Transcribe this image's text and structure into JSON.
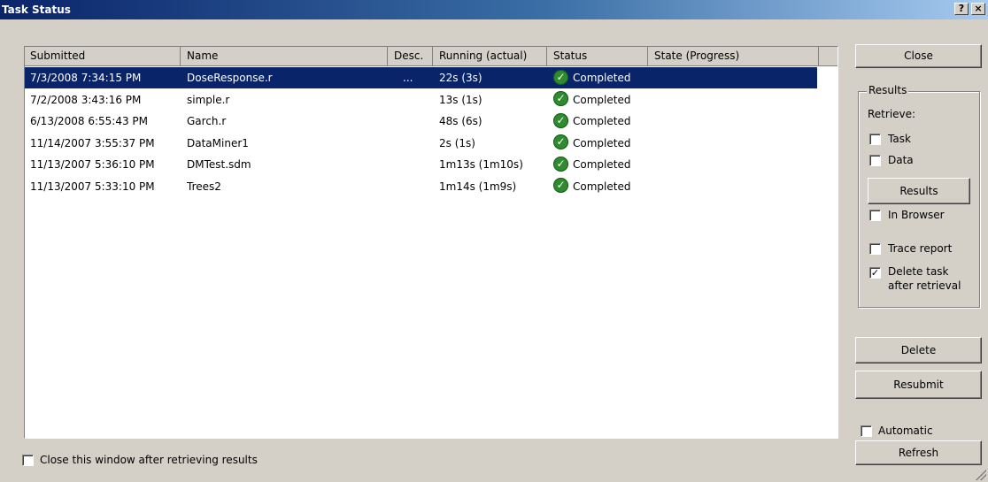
{
  "window": {
    "title": "Task Status",
    "help_label": "?",
    "close_label": "×"
  },
  "columns": [
    "Submitted",
    "Name",
    "Desc.",
    "Running (actual)",
    "Status",
    "State (Progress)"
  ],
  "tasks": [
    {
      "submitted": "7/3/2008 7:34:15 PM",
      "name": "DoseResponse.r",
      "desc": "...",
      "running": "22s (3s)",
      "status": "Completed",
      "state": "",
      "selected": true
    },
    {
      "submitted": "7/2/2008 3:43:16 PM",
      "name": "simple.r",
      "desc": "",
      "running": "13s (1s)",
      "status": "Completed",
      "state": ""
    },
    {
      "submitted": "6/13/2008 6:55:43 PM",
      "name": "Garch.r",
      "desc": "",
      "running": "48s (6s)",
      "status": "Completed",
      "state": ""
    },
    {
      "submitted": "11/14/2007 3:55:37 PM",
      "name": "DataMiner1",
      "desc": "",
      "running": "2s (1s)",
      "status": "Completed",
      "state": ""
    },
    {
      "submitted": "11/13/2007 5:36:10 PM",
      "name": "DMTest.sdm",
      "desc": "",
      "running": "1m13s (1m10s)",
      "status": "Completed",
      "state": ""
    },
    {
      "submitted": "11/13/2007 5:33:10 PM",
      "name": "Trees2",
      "desc": "",
      "running": "1m14s (1m9s)",
      "status": "Completed",
      "state": ""
    }
  ],
  "status_icon": "check-circle-icon",
  "right_panel": {
    "close_button": "Close",
    "results_group": "Results",
    "retrieve_label": "Retrieve:",
    "task_checkbox": {
      "label": "Task",
      "checked": false
    },
    "data_checkbox": {
      "label": "Data",
      "checked": false
    },
    "results_button": "Results",
    "in_browser_checkbox": {
      "label": "In Browser",
      "checked": false
    },
    "trace_report_checkbox": {
      "label": "Trace report",
      "checked": false
    },
    "delete_task_checkbox": {
      "label_line1": "Delete task",
      "label_line2": "after retrieval",
      "checked": true
    },
    "delete_button": "Delete",
    "resubmit_button": "Resubmit",
    "automatic_checkbox": {
      "label": "Automatic",
      "checked": false
    },
    "refresh_button": "Refresh"
  },
  "footer": {
    "close_after_checkbox": {
      "label": "Close this window after retrieving results",
      "checked": false
    }
  },
  "colors": {
    "selection": "#0a246a",
    "face": "#d4d0c8",
    "status_green": "#2e8b2e"
  }
}
